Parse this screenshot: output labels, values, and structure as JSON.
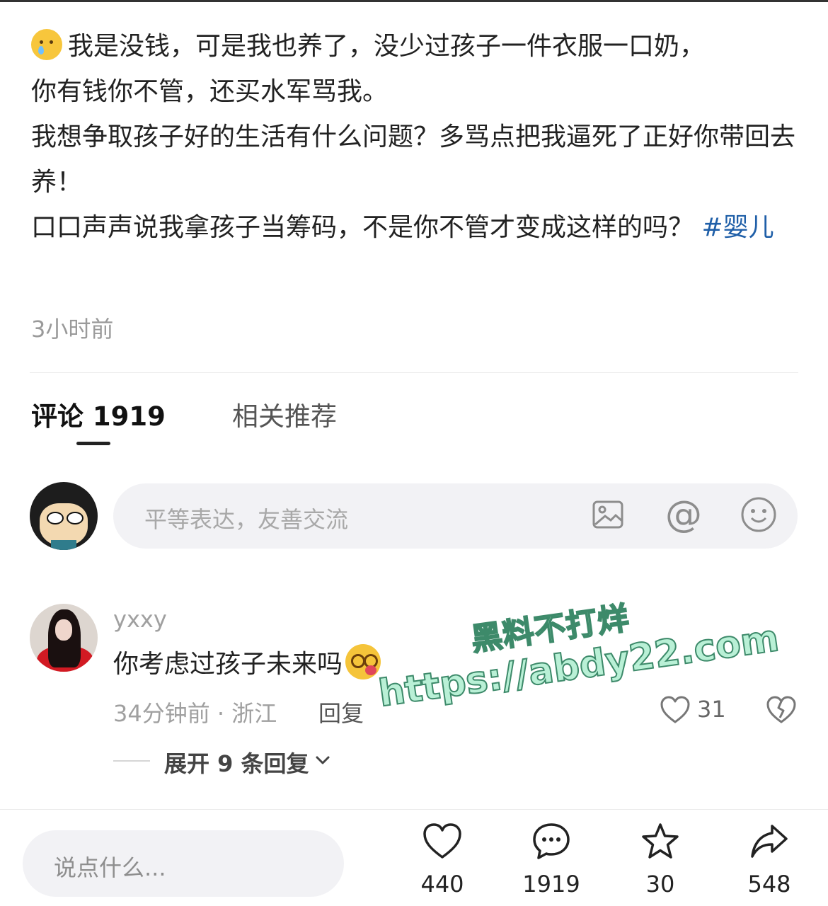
{
  "post": {
    "line1": "我是没钱，可是我也养了，没少过孩子一件衣服一口奶，",
    "line2": "你有钱你不管，还买水军骂我。",
    "line3": "我想争取孩子好的生活有什么问题？多骂点把我逼死了正好你带回去养！",
    "line4": "口口声声说我拿孩子当筹码，不是你不管才变成这样的吗？",
    "hashtag": "#婴儿",
    "time": "3小时前"
  },
  "tabs": {
    "comments": "评论 1919",
    "related": "相关推荐"
  },
  "comment_box": {
    "placeholder": "平等表达，友善交流",
    "at_symbol": "@"
  },
  "comment": {
    "username": "yxxy",
    "text": "你考虑过孩子未来吗",
    "meta": "34分钟前 · 浙江",
    "reply": "回复",
    "likes": "31",
    "expand": "展开 9 条回复"
  },
  "watermark": {
    "line1": "黑料不打烊",
    "line2": "https://abdy22.com"
  },
  "bottom_bar": {
    "placeholder": "说点什么...",
    "like_count": "440",
    "comment_count": "1919",
    "favorite_count": "30",
    "share_count": "548"
  },
  "icons": [
    "crying-face-emoji",
    "image-icon",
    "at-icon",
    "smiley-icon",
    "dizzy-face-emoji",
    "heart-icon",
    "broken-heart-icon",
    "chevron-down-icon",
    "chat-bubble-icon",
    "star-icon",
    "share-arrow-icon"
  ],
  "colors": {
    "hashtag": "#1f5fa8",
    "muted": "#a0a0a0",
    "input_bg": "#f2f2f5"
  }
}
